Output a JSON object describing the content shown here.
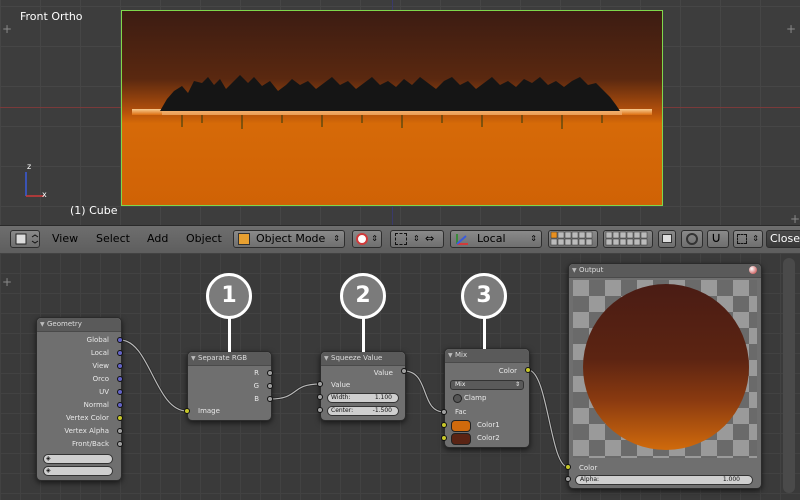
{
  "viewport": {
    "title": "Front Ortho",
    "object_label": "(1) Cube",
    "axis_z": "z",
    "axis_x": "x"
  },
  "header": {
    "menus": [
      "View",
      "Select",
      "Add",
      "Object"
    ],
    "mode": "Object Mode",
    "orientation": "Local",
    "snap_label": "Closes"
  },
  "nodes": {
    "geometry": {
      "title": "Geometry",
      "outputs": [
        "Global",
        "Local",
        "View",
        "Orco",
        "UV",
        "Normal",
        "Vertex Color",
        "Vertex Alpha",
        "Front/Back"
      ]
    },
    "separate_rgb": {
      "title": "Separate RGB",
      "outputs": [
        "R",
        "G",
        "B"
      ],
      "input": "Image"
    },
    "squeeze": {
      "title": "Squeeze Value",
      "output": "Value",
      "input": "Value",
      "width_label": "Width:",
      "width_value": "1.100",
      "center_label": "Center:",
      "center_value": "-1.500"
    },
    "mix": {
      "title": "Mix",
      "output": "Color",
      "blend_mode": "Mix",
      "clamp_label": "Clamp",
      "fac_label": "Fac",
      "color1_label": "Color1",
      "color2_label": "Color2",
      "color1_hex": "#d06a0c",
      "color2_hex": "#5a2414"
    },
    "output": {
      "title": "Output",
      "color_label": "Color",
      "alpha_label": "Alpha:",
      "alpha_value": "1.000"
    }
  },
  "annotations": {
    "badge1": "1",
    "badge2": "2",
    "badge3": "3"
  },
  "colors": {
    "frame_border": "#7fd84c",
    "sky_dark": "#3c1c12",
    "ground_orange": "#d06205",
    "vector_socket": "#6363c7",
    "color_socket": "#c7c729",
    "value_socket": "#a1a1a1"
  }
}
